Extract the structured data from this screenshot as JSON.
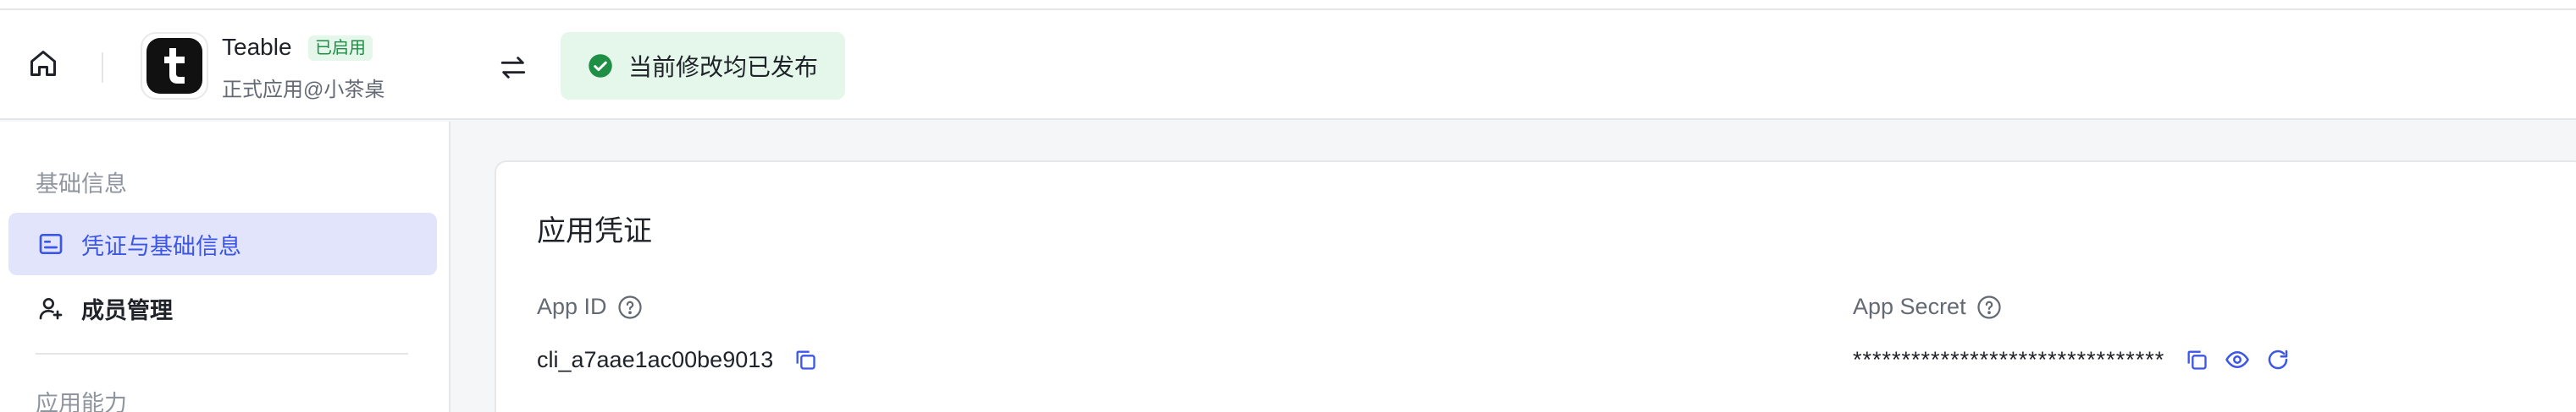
{
  "app": {
    "name": "Teable",
    "status": "已启用",
    "subtitle": "正式应用@小茶桌"
  },
  "publish": {
    "message": "当前修改均已发布"
  },
  "sidebar": {
    "section1_title": "基础信息",
    "items": [
      {
        "label": "凭证与基础信息",
        "active": true
      },
      {
        "label": "成员管理",
        "active": false
      }
    ],
    "section2_title": "应用能力"
  },
  "credentials": {
    "title": "应用凭证",
    "app_id_label": "App ID",
    "app_id_value": "cli_a7aae1ac00be9013",
    "app_secret_label": "App Secret",
    "app_secret_value": "********************************"
  },
  "colors": {
    "accent": "#3b56e8",
    "success": "#1f8f45",
    "success_bg": "#e4f7ea",
    "active_bg": "#e1e4fb"
  }
}
